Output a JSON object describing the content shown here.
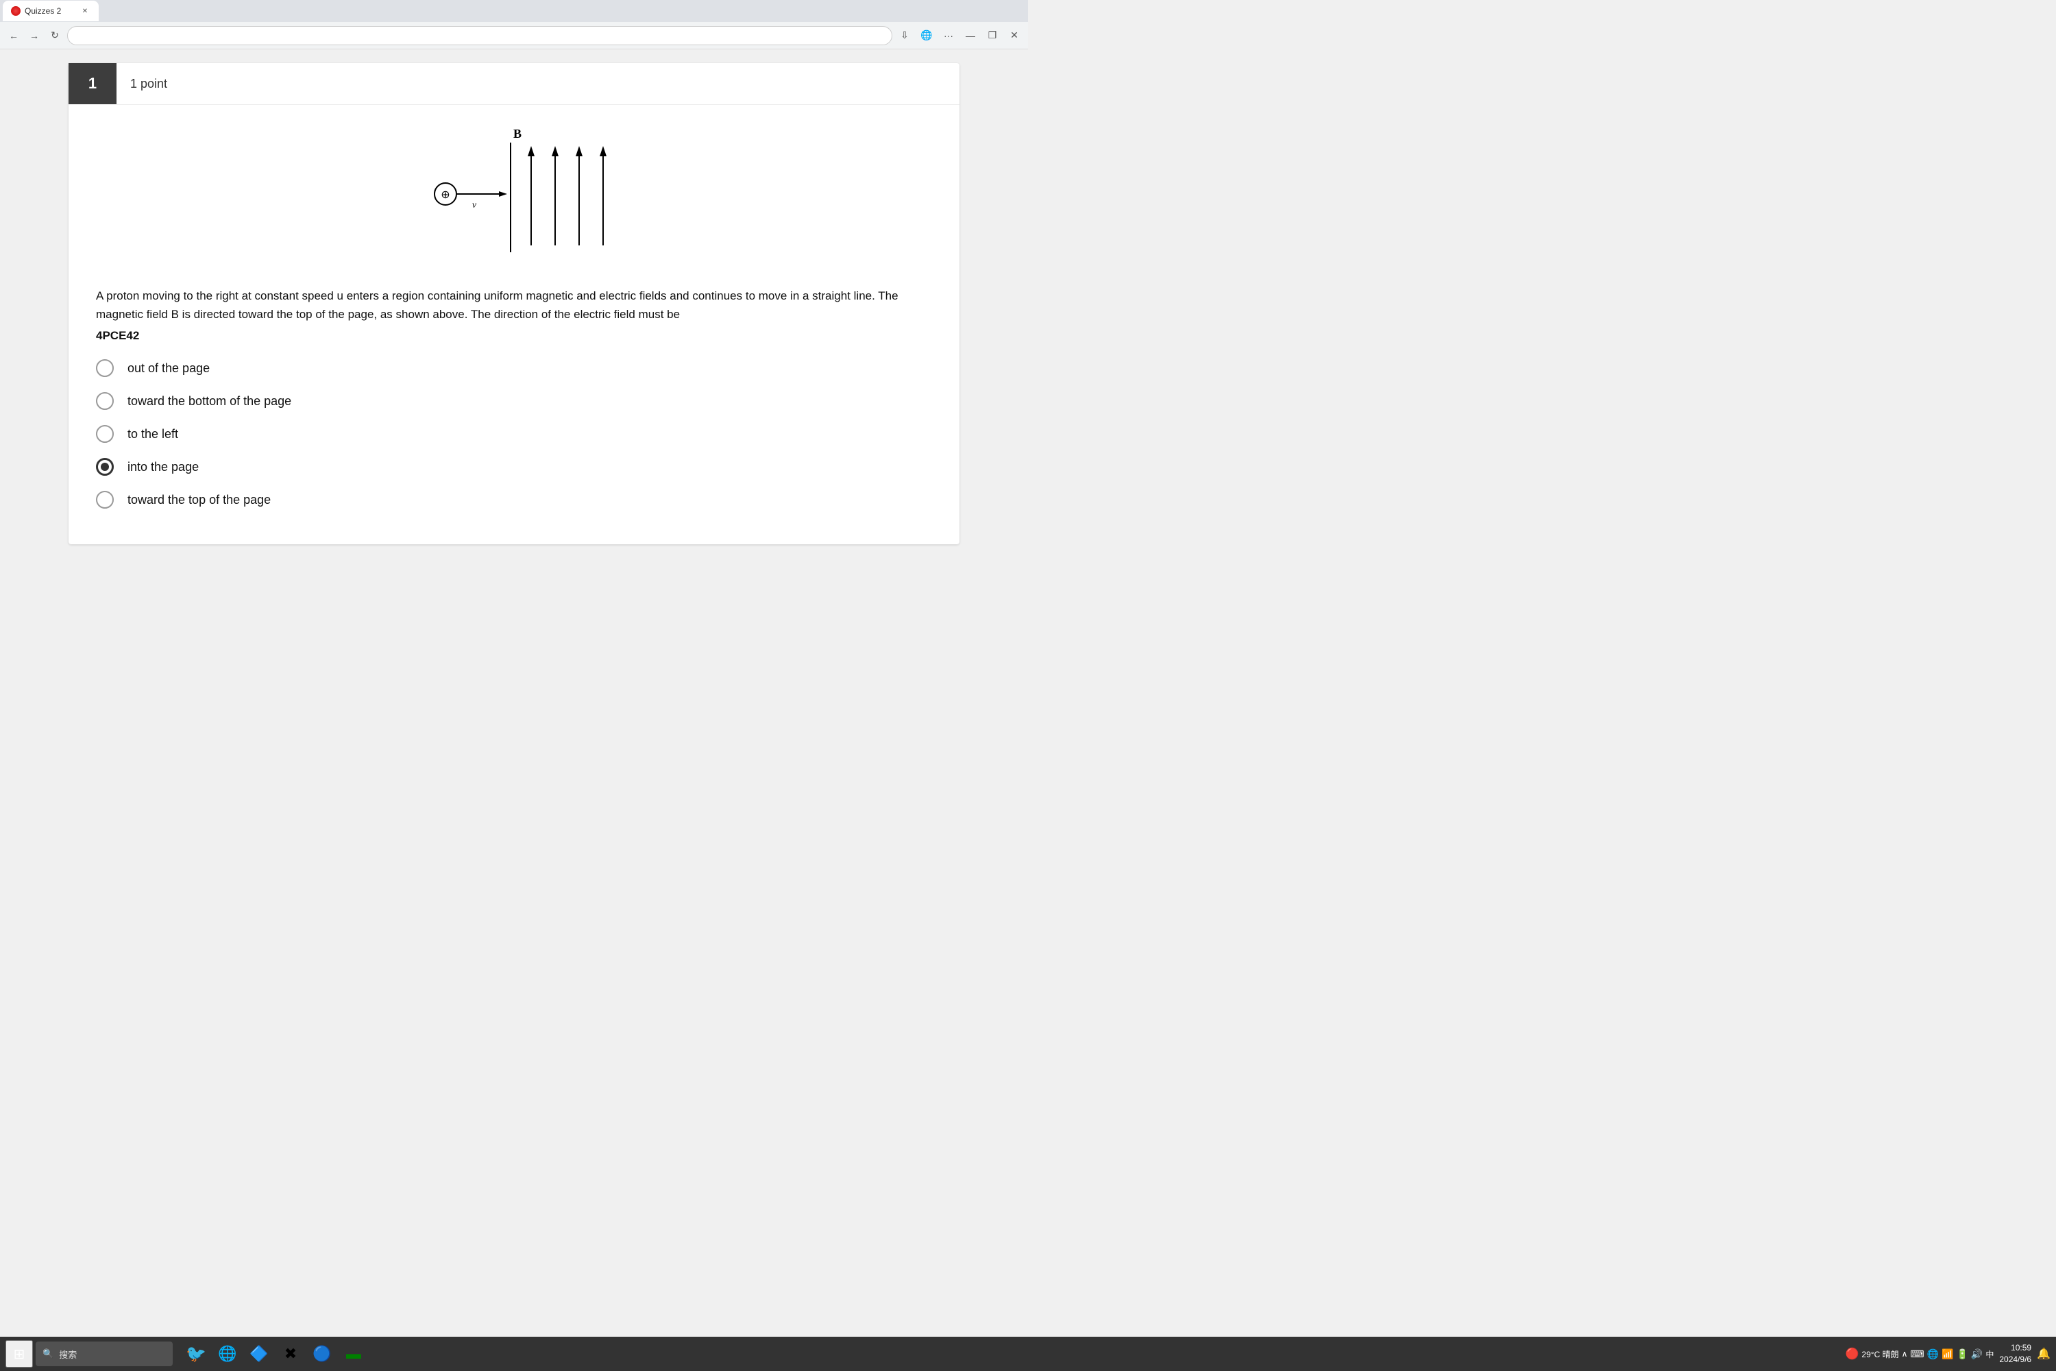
{
  "browser": {
    "tab_title": "Quizzes 2",
    "nav_back": "←",
    "nav_forward": "→",
    "nav_reload": "↺",
    "toolbar_download": "⬇",
    "toolbar_globe": "🌐",
    "toolbar_more": "···",
    "toolbar_minimize": "—",
    "toolbar_restore": "❐",
    "toolbar_close": "✕"
  },
  "question": {
    "number": "1",
    "points": "1 point",
    "code": "4PCE42",
    "text": "A proton moving to the right at constant speed u enters a region containing uniform magnetic and electric fields and continues to move in a straight line. The magnetic field B is directed toward the top of the page, as shown above. The direction of the electric field must be",
    "options": [
      {
        "label": "out of the page",
        "selected": false
      },
      {
        "label": "toward the bottom of the page",
        "selected": false
      },
      {
        "label": "to the left",
        "selected": false
      },
      {
        "label": "into the page",
        "selected": true
      },
      {
        "label": "toward the top of the page",
        "selected": false
      }
    ]
  },
  "taskbar": {
    "search_placeholder": "搜索",
    "time": "10:59",
    "date": "2024/9/6",
    "weather": "29°C 晴朗"
  }
}
